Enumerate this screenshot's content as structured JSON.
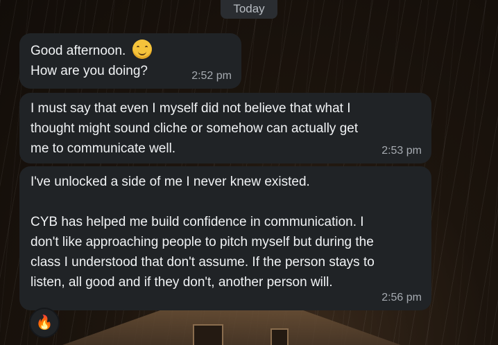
{
  "date_label": "Today",
  "messages": [
    {
      "line1": "Good afternoon.",
      "line2": "How are you doing?",
      "emoji": "smiling-face-emoji",
      "time": "2:52 pm"
    },
    {
      "text": "I must say that even I myself did not believe that what I\nthought might sound cliche or somehow can actually get\nme to communicate well.",
      "time": "2:53 pm"
    },
    {
      "text": "I've unlocked a side of me I never knew existed.\n\nCYB has helped me build confidence in communication. I\ndon't like approaching people to pitch myself but during the\nclass I understood that don't assume. If the person stays to\nlisten, all good and if they don't, another person will.",
      "time": "2:56 pm"
    }
  ],
  "reaction": {
    "icon": "fire-icon",
    "glyph": "🔥"
  }
}
